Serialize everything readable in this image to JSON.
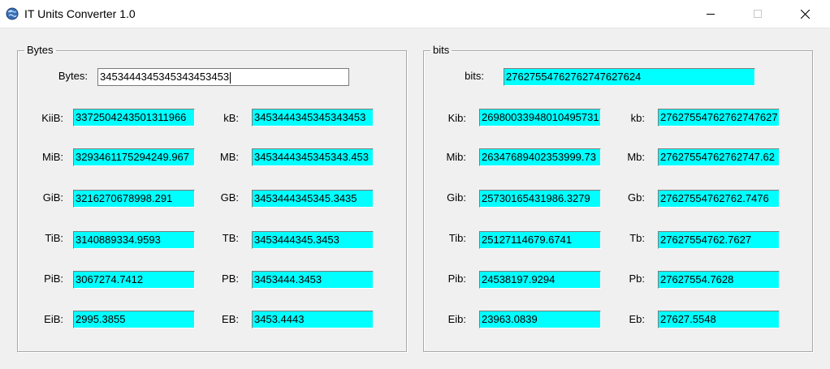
{
  "window": {
    "title": "IT Units Converter 1.0"
  },
  "bytes_group": {
    "legend": "Bytes",
    "input": {
      "label": "Bytes:",
      "value": "3453444345345343453453"
    },
    "binary": [
      {
        "label": "KiiB:",
        "value": "3372504243501311966"
      },
      {
        "label": "MiB:",
        "value": "3293461175294249.967"
      },
      {
        "label": "GiB:",
        "value": "3216270678998.291"
      },
      {
        "label": "TiB:",
        "value": "3140889334.9593"
      },
      {
        "label": "PiB:",
        "value": "3067274.7412"
      },
      {
        "label": "EiB:",
        "value": "2995.3855"
      }
    ],
    "decimal": [
      {
        "label": "kB:",
        "value": "3453444345345343453"
      },
      {
        "label": "MB:",
        "value": "3453444345345343.453"
      },
      {
        "label": "GB:",
        "value": "3453444345345.3435"
      },
      {
        "label": "TB:",
        "value": "3453444345.3453"
      },
      {
        "label": "PB:",
        "value": "3453444.3453"
      },
      {
        "label": "EB:",
        "value": "3453.4443"
      }
    ]
  },
  "bits_group": {
    "legend": "bits",
    "input": {
      "label": "bits:",
      "value": "27627554762762747627624"
    },
    "binary": [
      {
        "label": "Kib:",
        "value": "26980033948010495731"
      },
      {
        "label": "Mib:",
        "value": "26347689402353999.73"
      },
      {
        "label": "Gib:",
        "value": "25730165431986.3279"
      },
      {
        "label": "Tib:",
        "value": "25127114679.6741"
      },
      {
        "label": "Pib:",
        "value": "24538197.9294"
      },
      {
        "label": "Eib:",
        "value": "23963.0839"
      }
    ],
    "decimal": [
      {
        "label": "kb:",
        "value": "27627554762762747627"
      },
      {
        "label": "Mb:",
        "value": "27627554762762747.62"
      },
      {
        "label": "Gb:",
        "value": "27627554762762.7476"
      },
      {
        "label": "Tb:",
        "value": "27627554762.7627"
      },
      {
        "label": "Pb:",
        "value": "27627554.7628"
      },
      {
        "label": "Eb:",
        "value": "27627.5548"
      }
    ]
  },
  "colors": {
    "output_field": "#00ffff",
    "input_field": "#ffffff",
    "window_bg": "#f0f0f0"
  },
  "icons": [
    "globe-icon",
    "minimize-icon",
    "maximize-icon",
    "close-icon"
  ]
}
